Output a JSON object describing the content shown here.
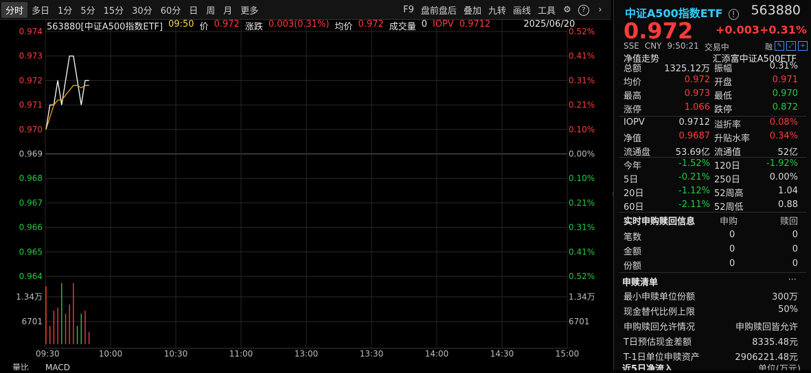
{
  "toolbar": {
    "tabs": [
      "分时",
      "多日",
      "1分",
      "5分",
      "15分",
      "30分",
      "60分",
      "日",
      "周",
      "月",
      "更多"
    ],
    "tools": [
      "F9",
      "盘前盘后",
      "叠加",
      "九转",
      "画线",
      "工具"
    ]
  },
  "header": {
    "code_name": "563880[中证A500指数ETF]",
    "time": "09:50",
    "price_label": "价",
    "price": "0.972",
    "chg_label": "涨跌",
    "chg": "0.003(0.31%)",
    "avg_label": "均价",
    "avg": "0.972",
    "vol_label": "成交量",
    "vol": "0",
    "iopv_label": "IOPV",
    "iopv": "0.9712",
    "date": "2025/06/20"
  },
  "chart_data": {
    "type": "line",
    "prev_close": 0.969,
    "y_ticks": [
      "0.974",
      "0.973",
      "0.972",
      "0.971",
      "0.970",
      "0.969",
      "0.968",
      "0.967",
      "0.966",
      "0.965",
      "0.964"
    ],
    "y_pct": [
      "0.52%",
      "0.41%",
      "0.31%",
      "0.21%",
      "0.10%",
      "0.00%",
      "0.10%",
      "0.21%",
      "0.31%",
      "0.41%",
      "0.52%"
    ],
    "vol_ticks": [
      "1.34万",
      "6701"
    ],
    "x_ticks": [
      "09:30",
      "10:00",
      "10:30",
      "11:00",
      "13:00",
      "13:30",
      "14:00",
      "14:30",
      "15:00"
    ],
    "series": [
      {
        "values": [
          0.97,
          0.971,
          0.971,
          0.972,
          0.971,
          0.972,
          0.973,
          0.973,
          0.972,
          0.971,
          0.972,
          0.972
        ]
      },
      {
        "values": [
          0.97,
          0.9705,
          0.971,
          0.9712,
          0.9712,
          0.9714,
          0.9716,
          0.9718,
          0.9718,
          0.9717,
          0.9718,
          0.9718
        ]
      }
    ],
    "volumes": [
      0.95,
      0.3,
      0.55,
      0.6,
      1.0,
      0.5,
      0.65,
      1.0,
      0.3,
      0.5,
      0.55,
      0.2
    ],
    "bottom_tabs": [
      "量比",
      "MACD"
    ]
  },
  "panel": {
    "name": "中证A500指数ETF",
    "code": "563880",
    "price": "0.972",
    "chg": "+0.003",
    "pct": "+0.31%",
    "exchange": "SSE",
    "currency": "CNY",
    "time": "9:50:21",
    "status": "交易中",
    "nav_trend": "净值走势",
    "fund_name": "汇添富中证A500ETF",
    "stats": [
      [
        "总额",
        "1325.12万",
        "振幅",
        "0.31%"
      ],
      [
        "均价",
        "0.972",
        "开盘",
        "0.971"
      ],
      [
        "最高",
        "0.973",
        "最低",
        "0.970"
      ],
      [
        "涨停",
        "1.066",
        "跌停",
        "0.872"
      ]
    ],
    "stats2": [
      [
        "IOPV",
        "0.9712",
        "溢折率",
        "0.08%"
      ],
      [
        "净值",
        "0.9687",
        "升贴水率",
        "0.34%"
      ],
      [
        "流通盘",
        "53.69亿",
        "流通值",
        "52亿"
      ]
    ],
    "perf": [
      [
        "今年",
        "-1.52%",
        "120日",
        "-1.92%"
      ],
      [
        "5日",
        "-0.21%",
        "250日",
        "0.00%"
      ],
      [
        "20日",
        "-1.12%",
        "52周高",
        "1.04"
      ],
      [
        "60日",
        "-2.11%",
        "52周低",
        "0.88"
      ]
    ],
    "sub_title": "实时申购赎回信息",
    "sub_col1": "申购",
    "sub_col2": "赎回",
    "sub_rows": [
      [
        "笔数",
        "0",
        "0"
      ],
      [
        "金额",
        "0",
        "0"
      ],
      [
        "份额",
        "0",
        "0"
      ]
    ],
    "list_title": "申赎清单",
    "more": "···",
    "list_rows": [
      [
        "最小申赎单位份额",
        "300万"
      ],
      [
        "现金替代比例上限",
        "50%"
      ],
      [
        "申购赎回允许情况",
        "申购赎回皆允许"
      ],
      [
        "T日预估现金差额",
        "8335.48元"
      ],
      [
        "T-1日单位申赎资产",
        "2906221.48元"
      ]
    ],
    "footer_cut": "近5日净流入",
    "footer_cut2": "单位(万元)"
  }
}
